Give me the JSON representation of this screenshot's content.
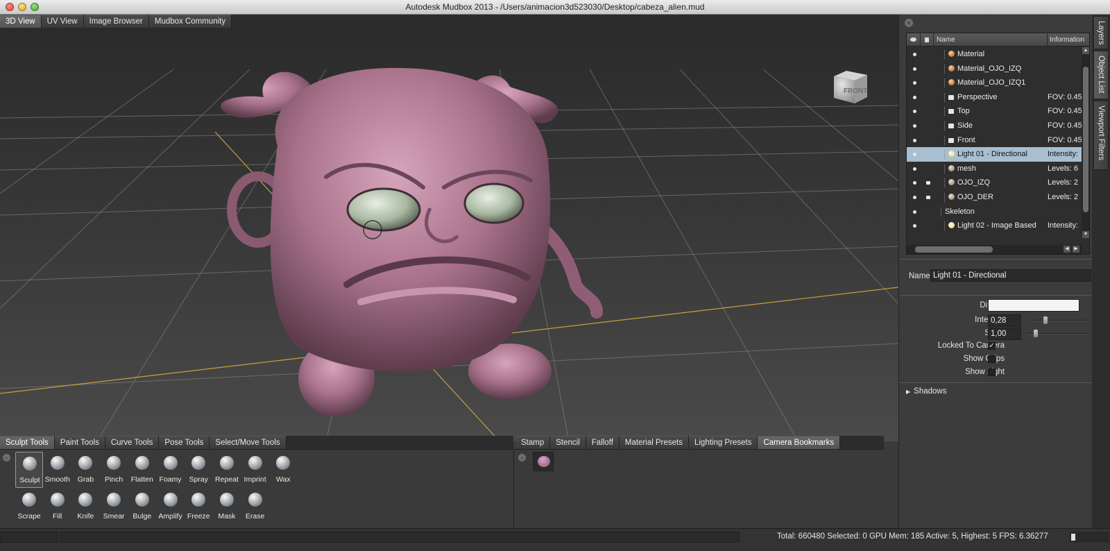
{
  "window": {
    "title": "Autodesk Mudbox 2013 - /Users/animacion3d523030/Desktop/cabeza_alien.mud"
  },
  "view_tabs": [
    "3D View",
    "UV View",
    "Image Browser",
    "Mudbox Community"
  ],
  "view_cube": {
    "label": "FRONT"
  },
  "side_tabs": [
    "Layers",
    "Object List",
    "Viewport Filters"
  ],
  "object_list": {
    "headers": {
      "name": "Name",
      "info": "Information"
    },
    "rows": [
      {
        "name": "Material",
        "info": "",
        "icon": "material-icon"
      },
      {
        "name": "Material_OJO_IZQ",
        "info": "",
        "icon": "material-icon"
      },
      {
        "name": "Material_OJO_IZQ1",
        "info": "",
        "icon": "material-icon"
      },
      {
        "name": "Perspective",
        "info": "FOV: 0.45",
        "icon": "camera-icon"
      },
      {
        "name": "Top",
        "info": "FOV: 0.45",
        "icon": "camera-icon"
      },
      {
        "name": "Side",
        "info": "FOV: 0.45",
        "icon": "camera-icon"
      },
      {
        "name": "Front",
        "info": "FOV: 0.45",
        "icon": "camera-icon"
      },
      {
        "name": "Light 01 - Directional",
        "info": "Intensity:",
        "icon": "light-icon",
        "selected": true
      },
      {
        "name": "mesh",
        "info": "Levels: 6",
        "icon": "mesh-icon"
      },
      {
        "name": "OJO_IZQ",
        "info": "Levels: 2",
        "icon": "mesh-icon",
        "locked": true
      },
      {
        "name": "OJO_DER",
        "info": "Levels: 2",
        "icon": "mesh-icon",
        "locked": true
      },
      {
        "name": "Skeleton",
        "info": "",
        "icon": ""
      },
      {
        "name": "Light 02 - Image Based",
        "info": "Intensity:",
        "icon": "light-icon"
      }
    ]
  },
  "properties": {
    "name_label": "Name",
    "name_value": "Light 01 - Directional",
    "diffuse_label": "Diffuse",
    "diffuse_color": "#f4f4f4",
    "intensity_label": "Intensity",
    "intensity_value": "0,28",
    "intensity_level": 0.28,
    "scale_label": "Scale",
    "scale_value": "1,00",
    "scale_level": 0.1,
    "locked_label": "Locked To Camera",
    "locked_checked": true,
    "locked_mark": "✓",
    "grips_label": "Show Grips",
    "showlight_label": "Show Light",
    "shadows_label": "Shadows"
  },
  "tool_tabs": [
    "Sculpt Tools",
    "Paint Tools",
    "Curve Tools",
    "Pose Tools",
    "Select/Move Tools"
  ],
  "sculpt_tools_row1": [
    "Sculpt",
    "Smooth",
    "Grab",
    "Pinch",
    "Flatten",
    "Foamy",
    "Spray",
    "Repeat",
    "Imprint",
    "Wax"
  ],
  "sculpt_tools_row2": [
    "Scrape",
    "Fill",
    "Knife",
    "Smear",
    "Bulge",
    "Amplify",
    "Freeze",
    "Mask",
    "Erase"
  ],
  "preset_tabs": [
    "Stamp",
    "Stencil",
    "Falloff",
    "Material Presets",
    "Lighting Presets",
    "Camera Bookmarks"
  ],
  "status": {
    "text": "Total: 660480  Selected: 0 GPU Mem: 185  Active: 5, Highest: 5  FPS: 6.36277",
    "progress": 0.12
  },
  "colors": {
    "selection": "#a7bfd0",
    "model_skin": "#b07a92",
    "eye": "#b9c8b4",
    "grid": "#9a9a9a",
    "grid_axis": "#c9a040"
  }
}
